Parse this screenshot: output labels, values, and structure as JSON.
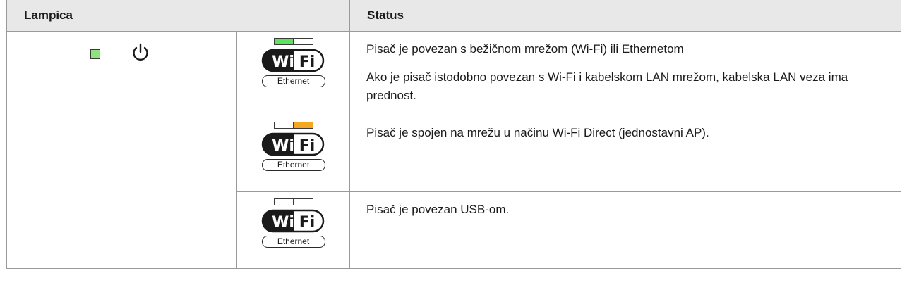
{
  "table": {
    "headers": {
      "lampica": "Lampica",
      "status": "Status"
    },
    "power_led": {
      "color": "#8ee37a",
      "state": "on",
      "icon": "power-icon"
    },
    "network_icon": {
      "wifi_label": "Wi Fi",
      "ethernet_label": "Ethernet"
    },
    "rows": [
      {
        "led_left_color": "#5ee35e",
        "led_right_color": "#ffffff",
        "lines": [
          "Pisač je povezan s bežičnom mrežom (Wi-Fi) ili Ethernetom",
          "Ako je pisač istodobno povezan s Wi-Fi i kabelskom LAN mrežom, kabelska LAN veza ima prednost."
        ]
      },
      {
        "led_left_color": "#ffffff",
        "led_right_color": "#f5a623",
        "lines": [
          "Pisač je spojen na mrežu u načinu Wi-Fi Direct (jednostavni AP)."
        ]
      },
      {
        "led_left_color": "#ffffff",
        "led_right_color": "#ffffff",
        "lines": [
          "Pisač je povezan USB-om."
        ]
      }
    ]
  }
}
